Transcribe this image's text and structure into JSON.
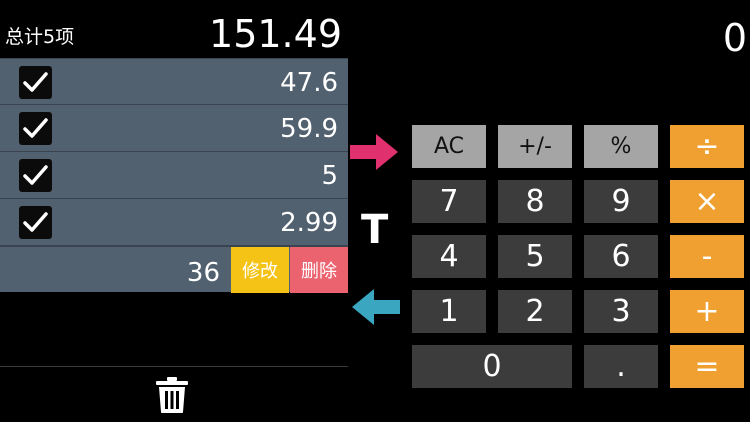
{
  "summary": {
    "label": "总计5项",
    "total": "151.49"
  },
  "items": [
    {
      "checked": true,
      "value": "47.6"
    },
    {
      "checked": true,
      "value": "59.9"
    },
    {
      "checked": true,
      "value": "5"
    },
    {
      "checked": true,
      "value": "2.99"
    }
  ],
  "edit_row": {
    "value": "36",
    "modify_label": "修改",
    "delete_label": "删除"
  },
  "calculator": {
    "display": "0",
    "input_marker": "T",
    "keys": {
      "ac": "AC",
      "sign": "+/-",
      "percent": "%",
      "divide": "÷",
      "seven": "7",
      "eight": "8",
      "nine": "9",
      "multiply": "×",
      "four": "4",
      "five": "5",
      "six": "6",
      "minus": "-",
      "one": "1",
      "two": "2",
      "three": "3",
      "plus": "+",
      "zero": "0",
      "dot": ".",
      "equals": "="
    }
  },
  "icons": {
    "checkbox": "checkmark-icon",
    "trash": "trash-icon",
    "arrow_in": "arrow-right-icon",
    "arrow_out": "arrow-left-icon"
  },
  "colors": {
    "row_bg": "#526170",
    "modify": "#f5c316",
    "delete": "#ec6370",
    "operator": "#f0a030",
    "function_key": "#a5a5a5",
    "digit_key": "#3c3c3c",
    "arrow_in": "#e0306e",
    "arrow_out": "#3aa6c0"
  }
}
